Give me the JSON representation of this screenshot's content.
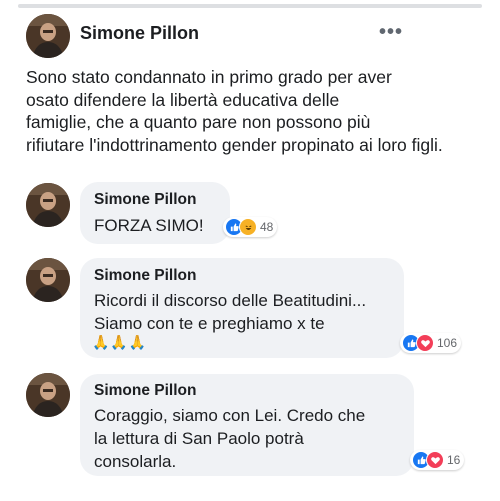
{
  "post": {
    "author": "Simone Pillon",
    "more_icon": "more-horizontal-icon",
    "text_lines": [
      "Sono stato condannato in primo grado per aver",
      "osato difendere la libertà educativa delle",
      "famiglie, che a quanto pare non possono più",
      "rifiutare l'indottrinamento gender propinato ai loro figli."
    ]
  },
  "comments": [
    {
      "author": "Simone Pillon",
      "lines": [
        "FORZA SIMO!"
      ],
      "reactions": [
        "like",
        "haha"
      ],
      "count": "48"
    },
    {
      "author": "Simone Pillon",
      "lines": [
        "Ricordi il discorso delle Beatitudini...",
        "Siamo con te e preghiamo x te"
      ],
      "emojis": "🙏🙏🙏",
      "reactions": [
        "like",
        "love"
      ],
      "count": "106"
    },
    {
      "author": "Simone Pillon",
      "lines": [
        "Coraggio, siamo con Lei. Credo che",
        "la lettura di San Paolo potrà",
        "consolarla."
      ],
      "reactions": [
        "like",
        "love"
      ],
      "count": "16"
    }
  ],
  "colors": {
    "like": "#1877f2",
    "love": "#f33e58",
    "haha": "#f7b125",
    "bubble": "#f0f2f5"
  }
}
